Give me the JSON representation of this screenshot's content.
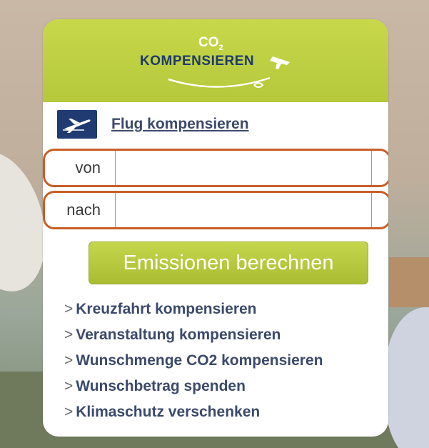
{
  "logo": {
    "co2": "CO",
    "co2_sub": "2",
    "text": "KOMPENSIEREN"
  },
  "flight": {
    "icon": "airplane-icon",
    "link_label": "Flug kompensieren"
  },
  "form": {
    "from_label": "von",
    "from_value": "",
    "to_label": "nach",
    "to_value": "",
    "submit_label": "Emissionen berechnen"
  },
  "links": [
    {
      "prefix": ">",
      "label": "Kreuzfahrt kompensieren"
    },
    {
      "prefix": ">",
      "label": "Veranstaltung kompensieren"
    },
    {
      "prefix": ">",
      "label": "Wunschmenge CO2 kompensieren"
    },
    {
      "prefix": ">",
      "label": "Wunschbetrag spenden"
    },
    {
      "prefix": ">",
      "label": "Klimaschutz verschenken"
    }
  ],
  "colors": {
    "header_green": "#b5c73b",
    "navy": "#1f3b72",
    "field_border": "#c75e25",
    "link_text": "#3b4a6b"
  }
}
